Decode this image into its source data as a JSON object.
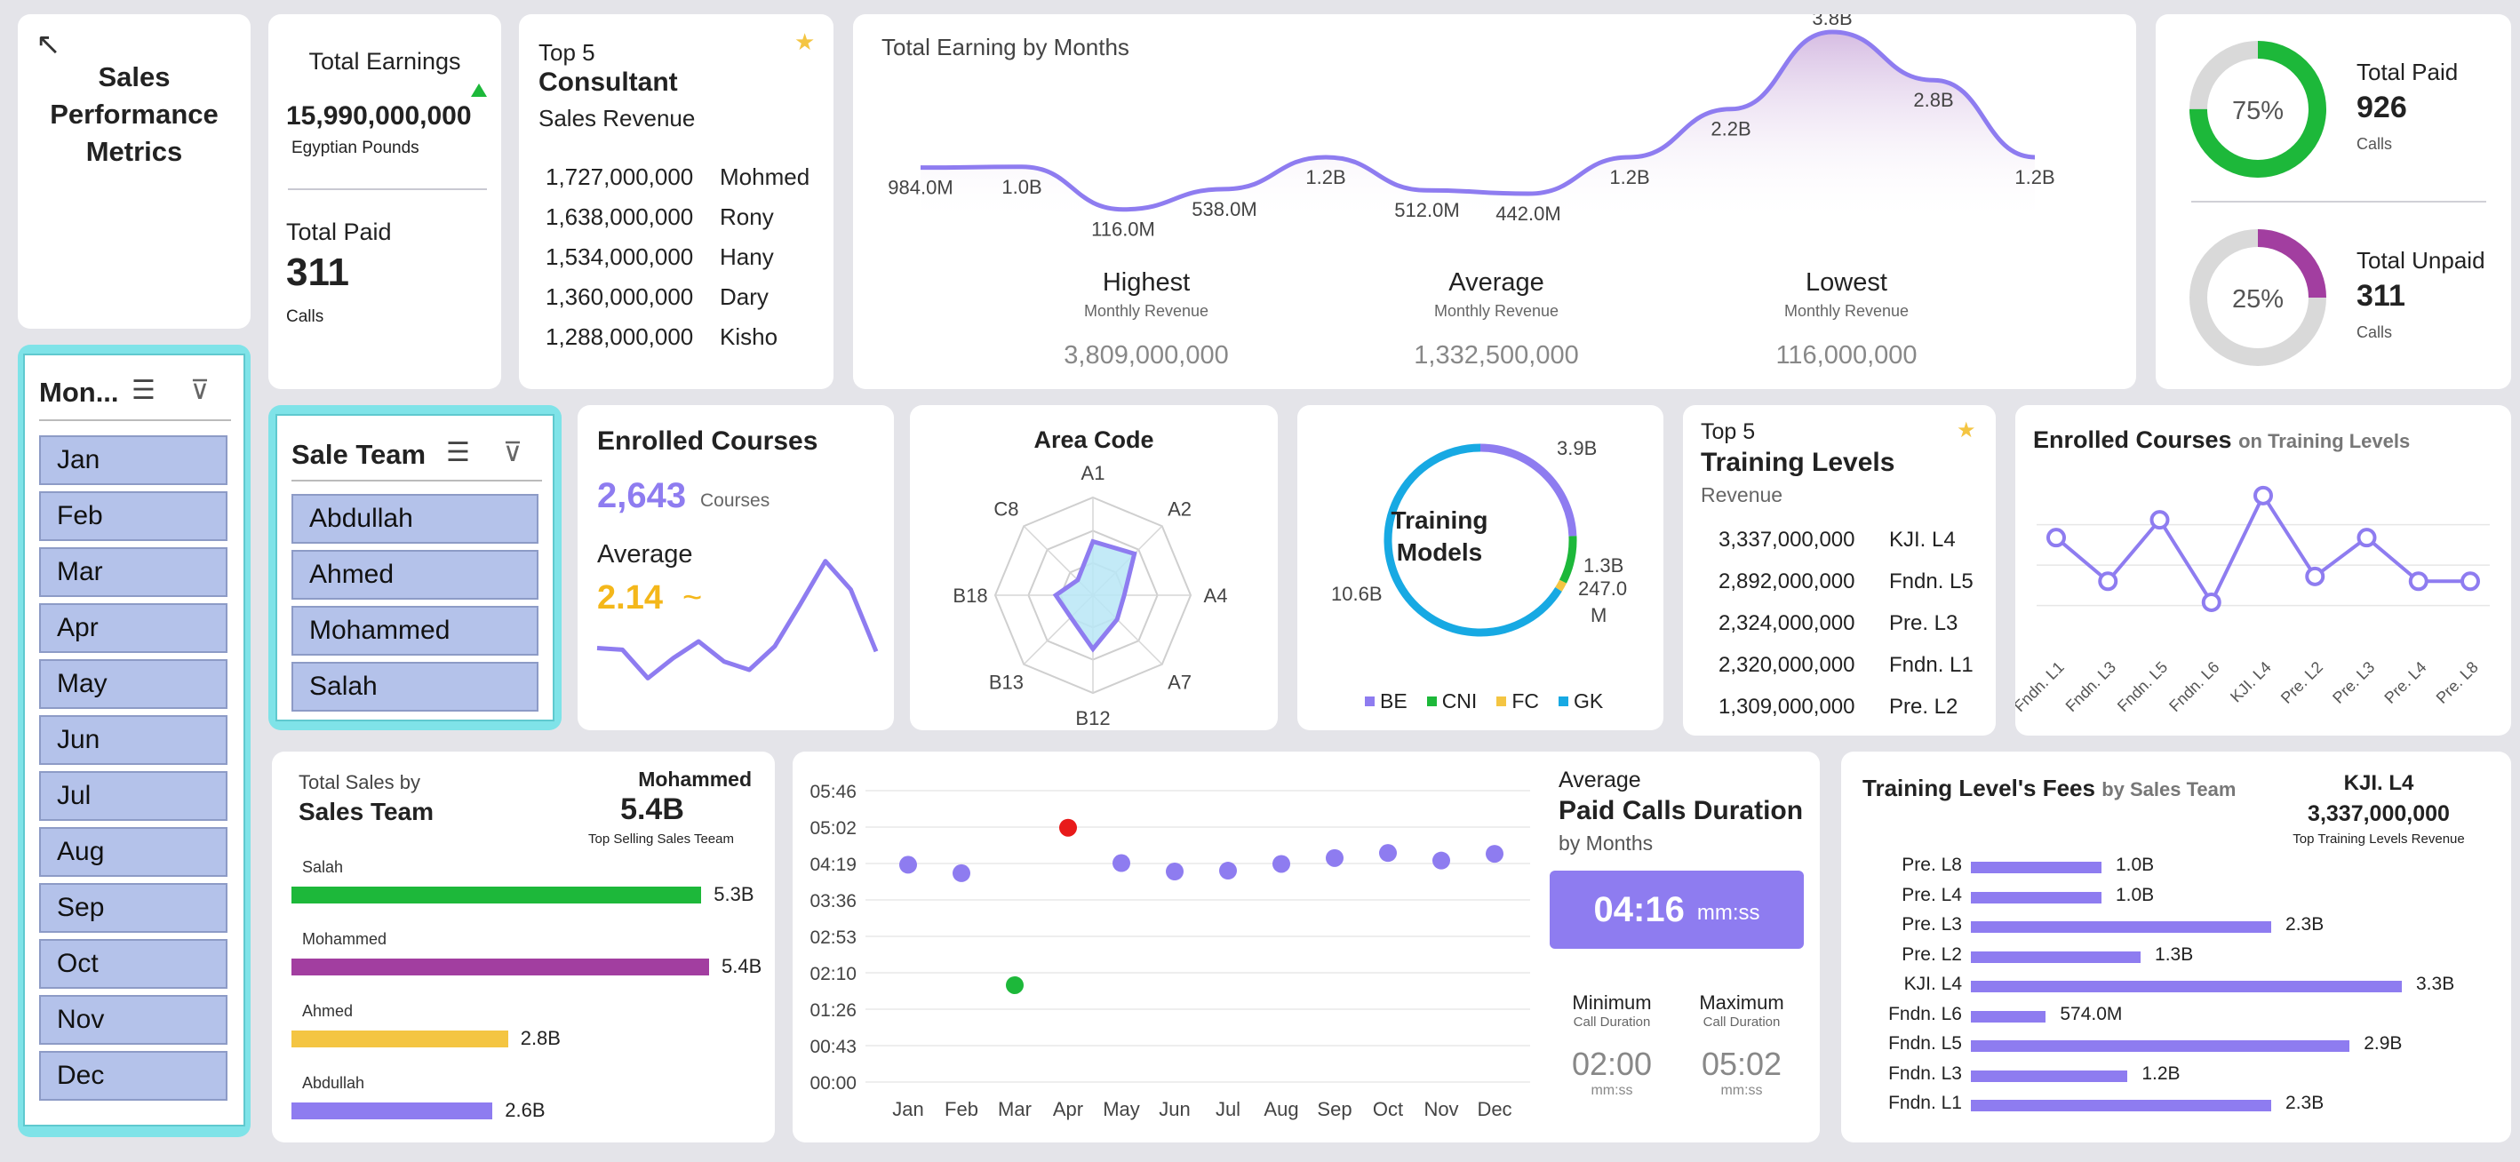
{
  "title": {
    "line1": "Sales",
    "line2": "Performance",
    "line3": "Metrics"
  },
  "earnings": {
    "label": "Total Earnings",
    "value": "15,990,000,000",
    "unit": "Egyptian Pounds",
    "paid_label": "Total Paid",
    "paid_value": "311",
    "paid_unit": "Calls"
  },
  "consultant": {
    "top": "Top 5",
    "title": "Consultant",
    "subtitle": "Sales Revenue",
    "rows": [
      {
        "value": "1,727,000,000",
        "name": "Mohmed"
      },
      {
        "value": "1,638,000,000",
        "name": "Rony"
      },
      {
        "value": "1,534,000,000",
        "name": "Hany"
      },
      {
        "value": "1,360,000,000",
        "name": "Dary"
      },
      {
        "value": "1,288,000,000",
        "name": "Kisho"
      }
    ]
  },
  "months_chart": {
    "title": "Total Earning by Months",
    "chart_data": {
      "type": "area",
      "series": [
        {
          "values": [
            984000000,
            1000000000,
            116000000,
            538000000,
            1200000000,
            512000000,
            442000000,
            1200000000,
            2200000000,
            3800000000,
            2800000000,
            1200000000
          ]
        }
      ],
      "data_labels": [
        "984.0M",
        "1.0B",
        "116.0M",
        "538.0M",
        "1.2B",
        "512.0M",
        "442.0M",
        "1.2B",
        "2.2B",
        "3.8B",
        "2.8B",
        "1.2B"
      ]
    },
    "stats": [
      {
        "label": "Highest",
        "sub": "Monthly Revenue",
        "value": "3,809,000,000"
      },
      {
        "label": "Average",
        "sub": "Monthly Revenue",
        "value": "1,332,500,000"
      },
      {
        "label": "Lowest",
        "sub": "Monthly Revenue",
        "value": "116,000,000"
      }
    ]
  },
  "paid_donut": {
    "pct": "75%",
    "fraction": 0.75,
    "label": "Total Paid",
    "value": "926",
    "unit": "Calls",
    "color": "#1db83a"
  },
  "unpaid_donut": {
    "pct": "25%",
    "fraction": 0.25,
    "label": "Total Unpaid",
    "value": "311",
    "unit": "Calls",
    "color": "#a23ea0"
  },
  "month_slicer": {
    "title": "Mon...",
    "items": [
      "Jan",
      "Feb",
      "Mar",
      "Apr",
      "May",
      "Jun",
      "Jul",
      "Aug",
      "Sep",
      "Oct",
      "Nov",
      "Dec"
    ]
  },
  "team_slicer": {
    "title": "Sale Team",
    "items": [
      "Abdullah",
      "Ahmed",
      "Mohammed",
      "Salah"
    ]
  },
  "enrolled": {
    "title": "Enrolled Courses",
    "value": "2,643",
    "unit": "Courses",
    "avg_label": "Average",
    "avg_value": "2.14",
    "avg_symbol": "~",
    "chart_data": {
      "type": "line",
      "values": [
        3,
        2.9,
        1.2,
        2.4,
        3.4,
        2.2,
        1.7,
        3.1,
        5.6,
        8.2,
        6.5,
        2.8
      ]
    }
  },
  "area_code": {
    "title": "Area Code",
    "chart_data": {
      "type": "radar",
      "categories": [
        "A1",
        "A2",
        "A4",
        "A7",
        "B12",
        "B13",
        "B18",
        "C8"
      ],
      "values": [
        0.55,
        0.6,
        0.32,
        0.35,
        0.55,
        0.32,
        0.38,
        0.22
      ]
    }
  },
  "training_models": {
    "title_line1": "Training",
    "title_line2": "Models",
    "chart_data": {
      "type": "pie",
      "categories": [
        "BE",
        "CNI",
        "FC",
        "GK"
      ],
      "values": [
        3.9,
        1.3,
        0.247,
        10.6
      ],
      "labels": [
        "3.9B",
        "1.3B",
        "247.0",
        "10.6B"
      ],
      "label_extra": "M"
    },
    "legend": [
      {
        "name": "BE",
        "color": "#8e7cf0"
      },
      {
        "name": "CNI",
        "color": "#1db83a"
      },
      {
        "name": "FC",
        "color": "#f4c542"
      },
      {
        "name": "GK",
        "color": "#17a9e3"
      }
    ]
  },
  "training_levels": {
    "top": "Top 5",
    "title": "Training Levels",
    "subtitle": "Revenue",
    "rows": [
      {
        "value": "3,337,000,000",
        "name": "KJI. L4"
      },
      {
        "value": "2,892,000,000",
        "name": "Fndn. L5"
      },
      {
        "value": "2,324,000,000",
        "name": "Pre. L3"
      },
      {
        "value": "2,320,000,000",
        "name": "Fndn. L1"
      },
      {
        "value": "1,309,000,000",
        "name": "Pre. L2"
      }
    ]
  },
  "enrolled_levels": {
    "title": "Enrolled Courses",
    "title_suffix": "on Training Levels",
    "chart_data": {
      "type": "line",
      "categories": [
        "Fndn. L1",
        "Fndn. L3",
        "Fndn. L5",
        "Fndn. L6",
        "KJI. L4",
        "Pre. L2",
        "Pre. L3",
        "Pre. L4",
        "Pre. L8"
      ],
      "values": [
        0.62,
        0.35,
        0.73,
        0.22,
        0.88,
        0.38,
        0.62,
        0.35,
        0.35
      ]
    }
  },
  "sales_team": {
    "label": "Total Sales by",
    "title": "Sales Team",
    "top_name": "Mohammed",
    "top_value": "5.4B",
    "top_caption": "Top Selling Sales Teeam",
    "chart_data": {
      "type": "bar",
      "categories": [
        "Salah",
        "Mohammed",
        "Ahmed",
        "Abdullah"
      ],
      "values": [
        5.3,
        5.4,
        2.8,
        2.6
      ],
      "labels": [
        "5.3B",
        "5.4B",
        "2.8B",
        "2.6B"
      ],
      "colors": [
        "#1db83a",
        "#a23ea0",
        "#f4c542",
        "#8e7cf0"
      ]
    }
  },
  "duration_chart": {
    "chart_data": {
      "type": "scatter",
      "categories": [
        "Jan",
        "Feb",
        "Mar",
        "Apr",
        "May",
        "Jun",
        "Jul",
        "Aug",
        "Sep",
        "Oct",
        "Nov",
        "Dec"
      ],
      "values": [
        258,
        248,
        115,
        302,
        260,
        250,
        251,
        259,
        266,
        272,
        263,
        271
      ],
      "colors": [
        "#8e7cf0",
        "#8e7cf0",
        "#1db83a",
        "#e81a1a",
        "#8e7cf0",
        "#8e7cf0",
        "#8e7cf0",
        "#8e7cf0",
        "#8e7cf0",
        "#8e7cf0",
        "#8e7cf0",
        "#8e7cf0"
      ],
      "yticks": [
        "05:46",
        "05:02",
        "04:19",
        "03:36",
        "02:53",
        "02:10",
        "01:26",
        "00:43",
        "00:00"
      ]
    }
  },
  "avg_duration": {
    "label": "Average",
    "title": "Paid Calls Duration",
    "sub": "by Months",
    "value": "04:16",
    "unit": "mm:ss",
    "min_label": "Minimum",
    "min_sub": "Call Duration",
    "min_value": "02:00",
    "min_unit": "mm:ss",
    "max_label": "Maximum",
    "max_sub": "Call Duration",
    "max_value": "05:02",
    "max_unit": "mm:ss"
  },
  "fees": {
    "title": "Training Level's Fees",
    "title_suffix": "by Sales Team",
    "top_name": "KJI. L4",
    "top_value": "3,337,000,000",
    "top_caption": "Top Training Levels Revenue",
    "chart_data": {
      "type": "bar",
      "categories": [
        "Pre. L8",
        "Pre. L4",
        "Pre. L3",
        "Pre. L2",
        "KJI. L4",
        "Fndn. L6",
        "Fndn. L5",
        "Fndn. L3",
        "Fndn. L1"
      ],
      "values": [
        1.0,
        1.0,
        2.3,
        1.3,
        3.3,
        0.574,
        2.9,
        1.2,
        2.3
      ],
      "labels": [
        "1.0B",
        "1.0B",
        "2.3B",
        "1.3B",
        "3.3B",
        "574.0M",
        "2.9B",
        "1.2B",
        "2.3B"
      ]
    }
  }
}
